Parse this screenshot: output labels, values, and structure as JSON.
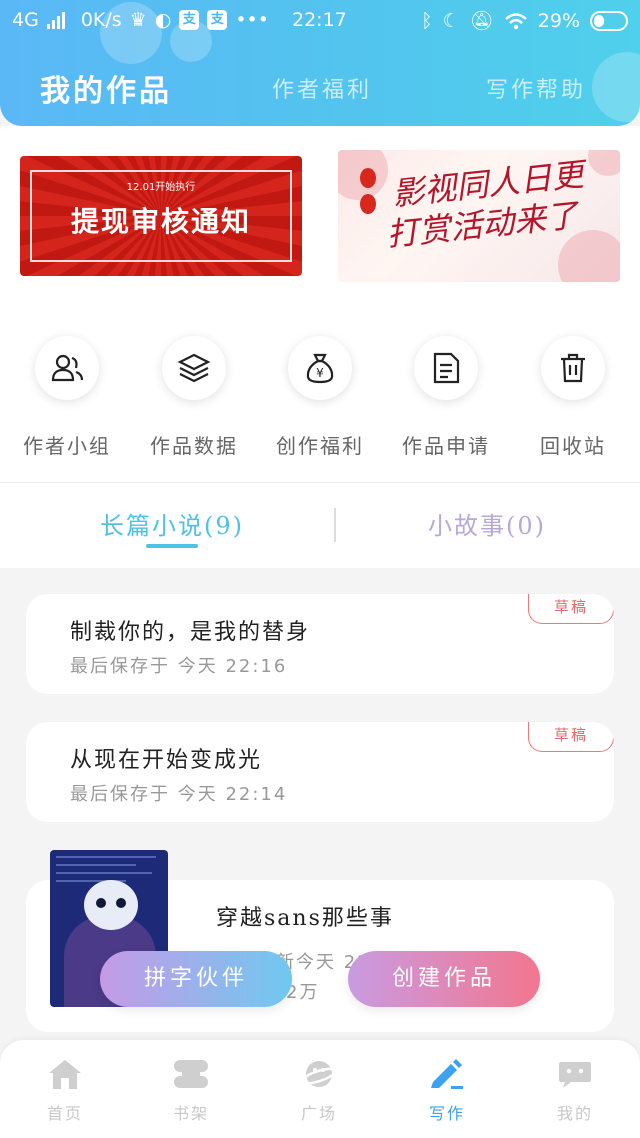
{
  "status_bar": {
    "network": "4G",
    "speed": "0K/s",
    "time": "22:17",
    "battery": "29%",
    "badge_char": "支"
  },
  "top_tabs": [
    {
      "label": "我的作品",
      "active": true
    },
    {
      "label": "作者福利",
      "active": false
    },
    {
      "label": "写作帮助",
      "active": false
    }
  ],
  "banners": {
    "left": {
      "small": "12.01开始执行",
      "title": "提现审核通知"
    },
    "right": {
      "title_line1": "影视同人日更",
      "title_line2": "打赏活动来了"
    }
  },
  "quick_actions": [
    {
      "label": "作者小组",
      "icon": "people-icon"
    },
    {
      "label": "作品数据",
      "icon": "layers-icon"
    },
    {
      "label": "创作福利",
      "icon": "money-bag-icon"
    },
    {
      "label": "作品申请",
      "icon": "document-icon"
    },
    {
      "label": "回收站",
      "icon": "trash-icon"
    }
  ],
  "sub_tabs": [
    {
      "label": "长篇小说(9)",
      "active": true
    },
    {
      "label": "小故事(0)",
      "active": false
    }
  ],
  "works": [
    {
      "title": "制裁你的，是我的替身",
      "meta": "最后保存于  今天  22:16",
      "badge": "草稿"
    },
    {
      "title": "从现在开始变成光",
      "meta": "最后保存于  今天  22:14",
      "badge": "草稿"
    },
    {
      "title": "穿越sans那些事",
      "meta": "最后更新今天  22:12",
      "stat": "2万"
    }
  ],
  "floating_buttons": {
    "left": "拼字伙伴",
    "right": "创建作品"
  },
  "bottom_nav": [
    {
      "label": "首页",
      "icon": "home-icon",
      "active": false
    },
    {
      "label": "书架",
      "icon": "bookshelf-icon",
      "active": false
    },
    {
      "label": "广场",
      "icon": "planet-icon",
      "active": false
    },
    {
      "label": "写作",
      "icon": "pen-icon",
      "active": true
    },
    {
      "label": "我的",
      "icon": "chat-face-icon",
      "active": false
    }
  ],
  "colors": {
    "header_gradient_start": "#5ab8f6",
    "header_gradient_end": "#4fd0ec",
    "active_tab": "#4fc1e6",
    "inactive_tab": "#b8a8d8",
    "draft_badge": "#e06a6e",
    "nav_active": "#3aa2ee"
  }
}
